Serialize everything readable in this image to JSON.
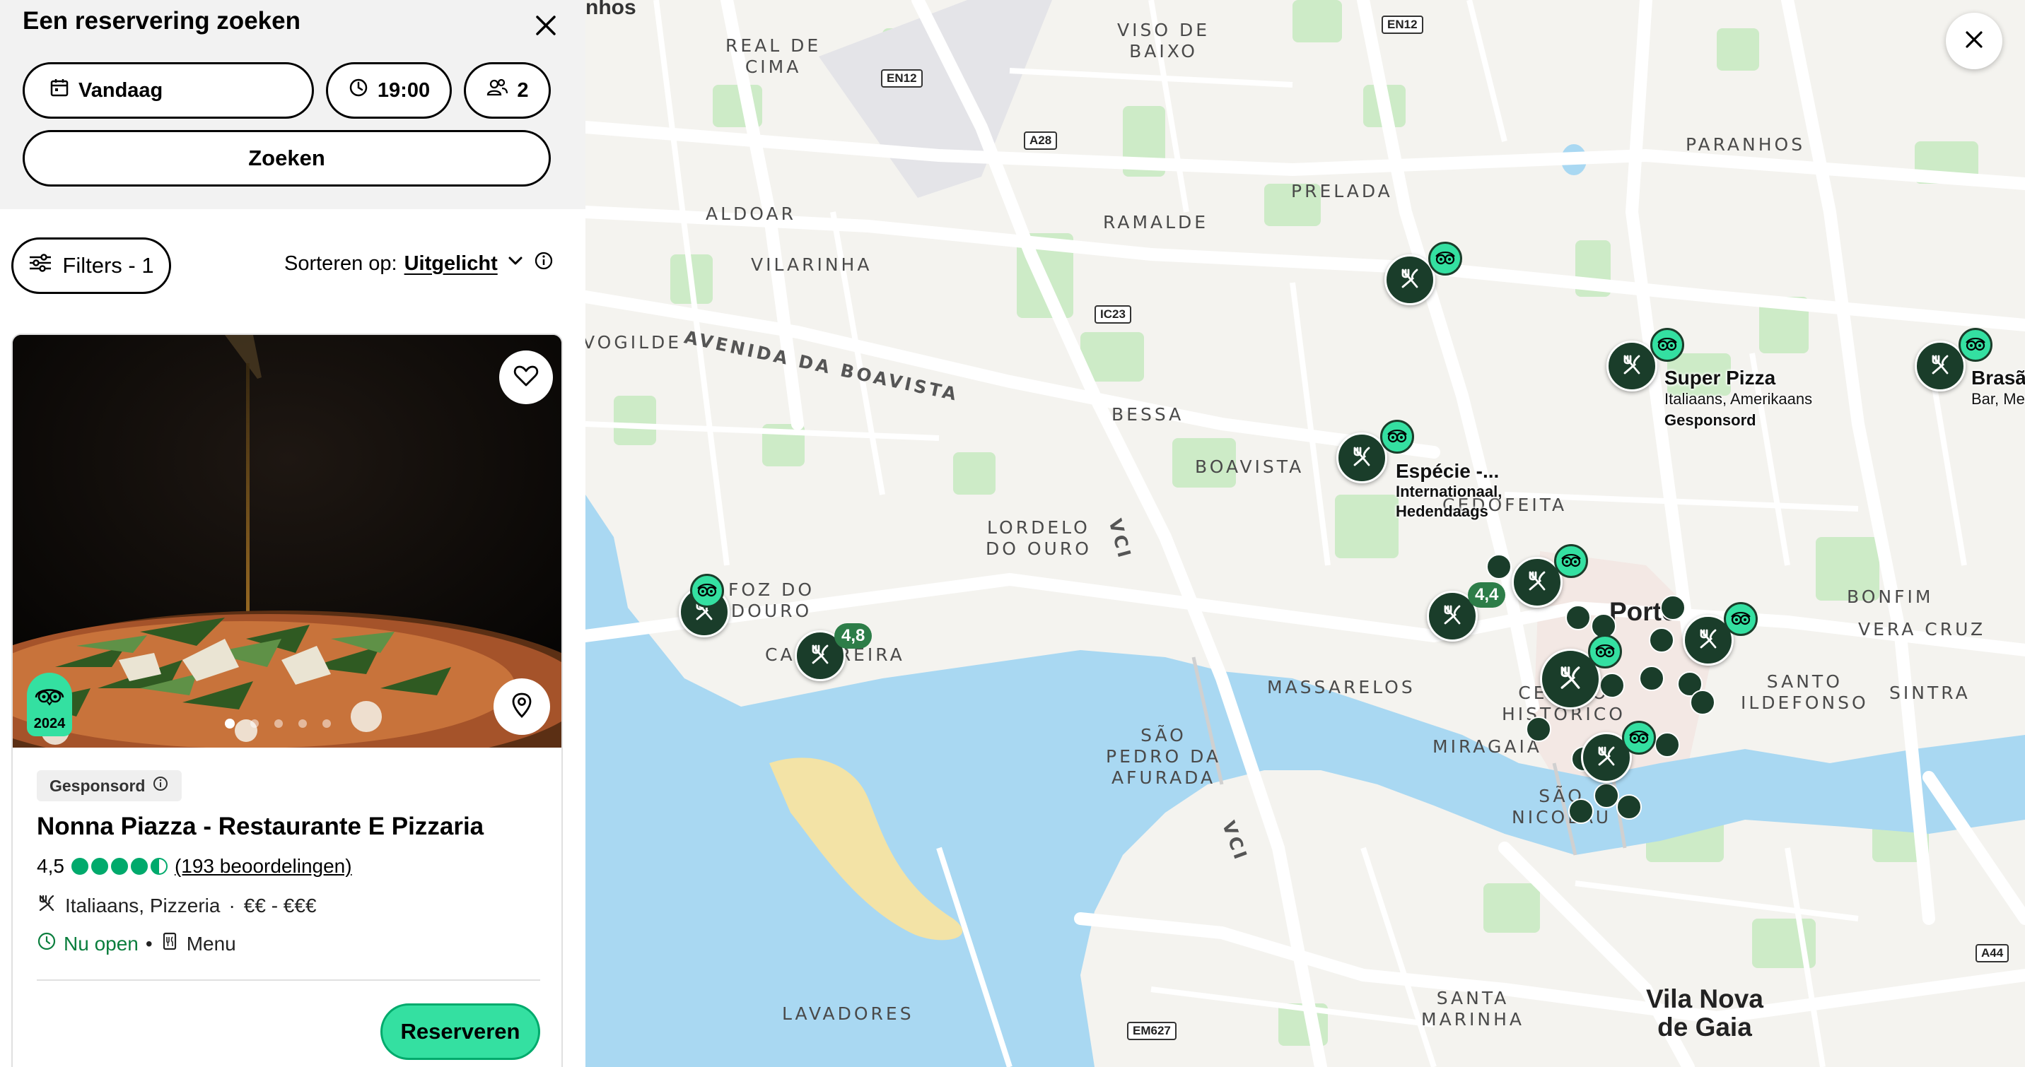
{
  "panel": {
    "title": "Een reservering zoeken",
    "date": "Vandaag",
    "time": "19:00",
    "guests": "2",
    "search_label": "Zoeken",
    "filters_label": "Filters - 1",
    "sort_prefix": "Sorteren op:",
    "sort_value": "Uitgelicht"
  },
  "card": {
    "award_year": "2024",
    "sponsored_label": "Gesponsord",
    "name": "Nonna Piazza - Restaurante E Pizzaria",
    "rating": "4,5",
    "rating_value": 4.5,
    "reviews": "(193 beoordelingen)",
    "cuisine": "Italiaans, Pizzeria",
    "price": "€€ - €€€",
    "open_status": "Nu open",
    "menu_label": "Menu",
    "reserve_label": "Reserveren",
    "carousel_count": 5,
    "carousel_active": 1
  },
  "map": {
    "area_labels": [
      "nhos",
      "VISO DE\nBAIXO",
      "REAL DE\nCIMA",
      "ALDOAR",
      "RAMALDE",
      "PRELADA",
      "PARANHOS",
      "VILARINHA",
      "VOGILDE",
      "AVENIDA DA BOAVISTA",
      "BESSA",
      "BOAVISTA",
      "CEDOFEITA",
      "LORDELO\nDO OURO",
      "FOZ DO\nDOURO",
      "CANTAREIRA",
      "MASSARELOS",
      "BONFIM",
      "VERA CRUZ",
      "SINTRA",
      "SÃO\nPEDRO DA\nAFURADA",
      "MIRAGAIA",
      "CENTRO\nHISTÓRICO",
      "SANTO\nILDEFONSO",
      "SÃO\nNICOLAU",
      "SANTA\nMARINHA",
      "LAVADORES",
      "VCI",
      "VCI"
    ],
    "city_labels": [
      "Porto",
      "Vila Nova\nde Gaia"
    ],
    "road_shields": [
      "EN12",
      "EN12",
      "A28",
      "IC23",
      "EM627",
      "A44"
    ],
    "pois": [
      {
        "name": "Super Pizza",
        "cuisine": "Italiaans, Amerikaans",
        "sponsored": "Gesponsord"
      },
      {
        "name": "Espécie -...",
        "cuisine": "Internationaal,\nHedendaags"
      },
      {
        "name": "Brasã",
        "cuisine": "Bar, Me"
      }
    ],
    "badges": [
      "4,8",
      "4,4"
    ]
  },
  "colors": {
    "accent_green": "#34e0a1",
    "pin_dark": "#1a3d2a",
    "water": "#a9d8f2",
    "park": "#cdebc7"
  }
}
